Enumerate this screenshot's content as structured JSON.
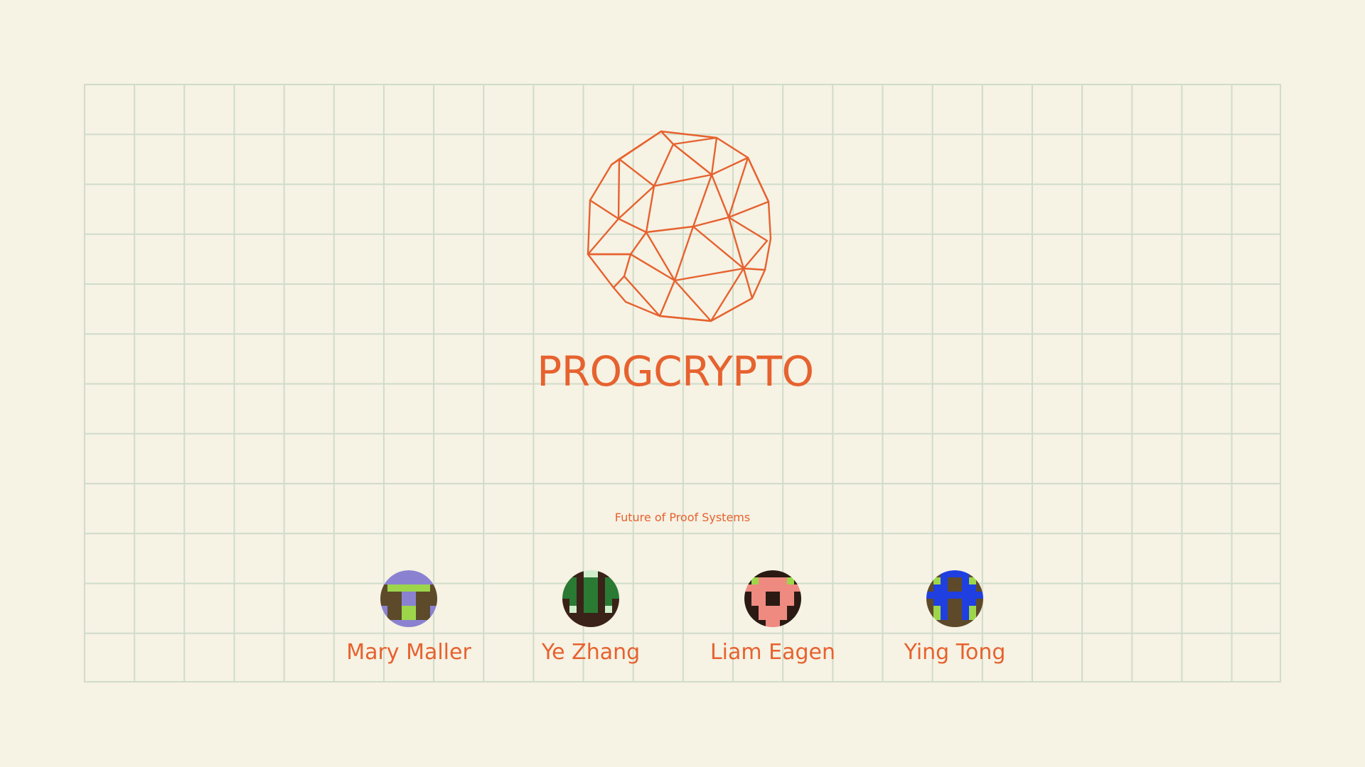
{
  "title": "PROGCRYPTO",
  "subtitle": "Future of Proof Systems",
  "colors": {
    "background": "#f6f2e4",
    "accent": "#e6622f",
    "grid": "#cfdcc9"
  },
  "logo": {
    "icon": "geodesic-sphere-icon"
  },
  "speakers": [
    {
      "name": "Mary Maller",
      "avatar_palette": [
        "#5d4a2a",
        "#8a82d0",
        "#9dd64a"
      ],
      "avatar_pixels": [
        "11111111",
        "11111111",
        "02222220",
        "00011000",
        "00011000",
        "10022001",
        "10022001",
        "11111111"
      ]
    },
    {
      "name": "Ye Zhang",
      "avatar_palette": [
        "#2a7a34",
        "#3a2218",
        "#cfeecb"
      ],
      "avatar_pixels": [
        "11122111",
        "00100100",
        "00100100",
        "00100100",
        "10100101",
        "12100121",
        "11111111",
        "11111111"
      ]
    },
    {
      "name": "Liam Eagen",
      "avatar_palette": [
        "#2b1a14",
        "#ee8a80",
        "#9dd64a"
      ],
      "avatar_pixels": [
        "00000000",
        "02111120",
        "11111111",
        "01100110",
        "01100110",
        "00111100",
        "00111100",
        "00011000"
      ]
    },
    {
      "name": "Ying Tong",
      "avatar_palette": [
        "#5e4a2a",
        "#1f3fe0",
        "#9dd64a"
      ],
      "avatar_pixels": [
        "00111100",
        "02100120",
        "01100110",
        "11111111",
        "01100110",
        "02100120",
        "02100120",
        "00000000"
      ]
    }
  ]
}
